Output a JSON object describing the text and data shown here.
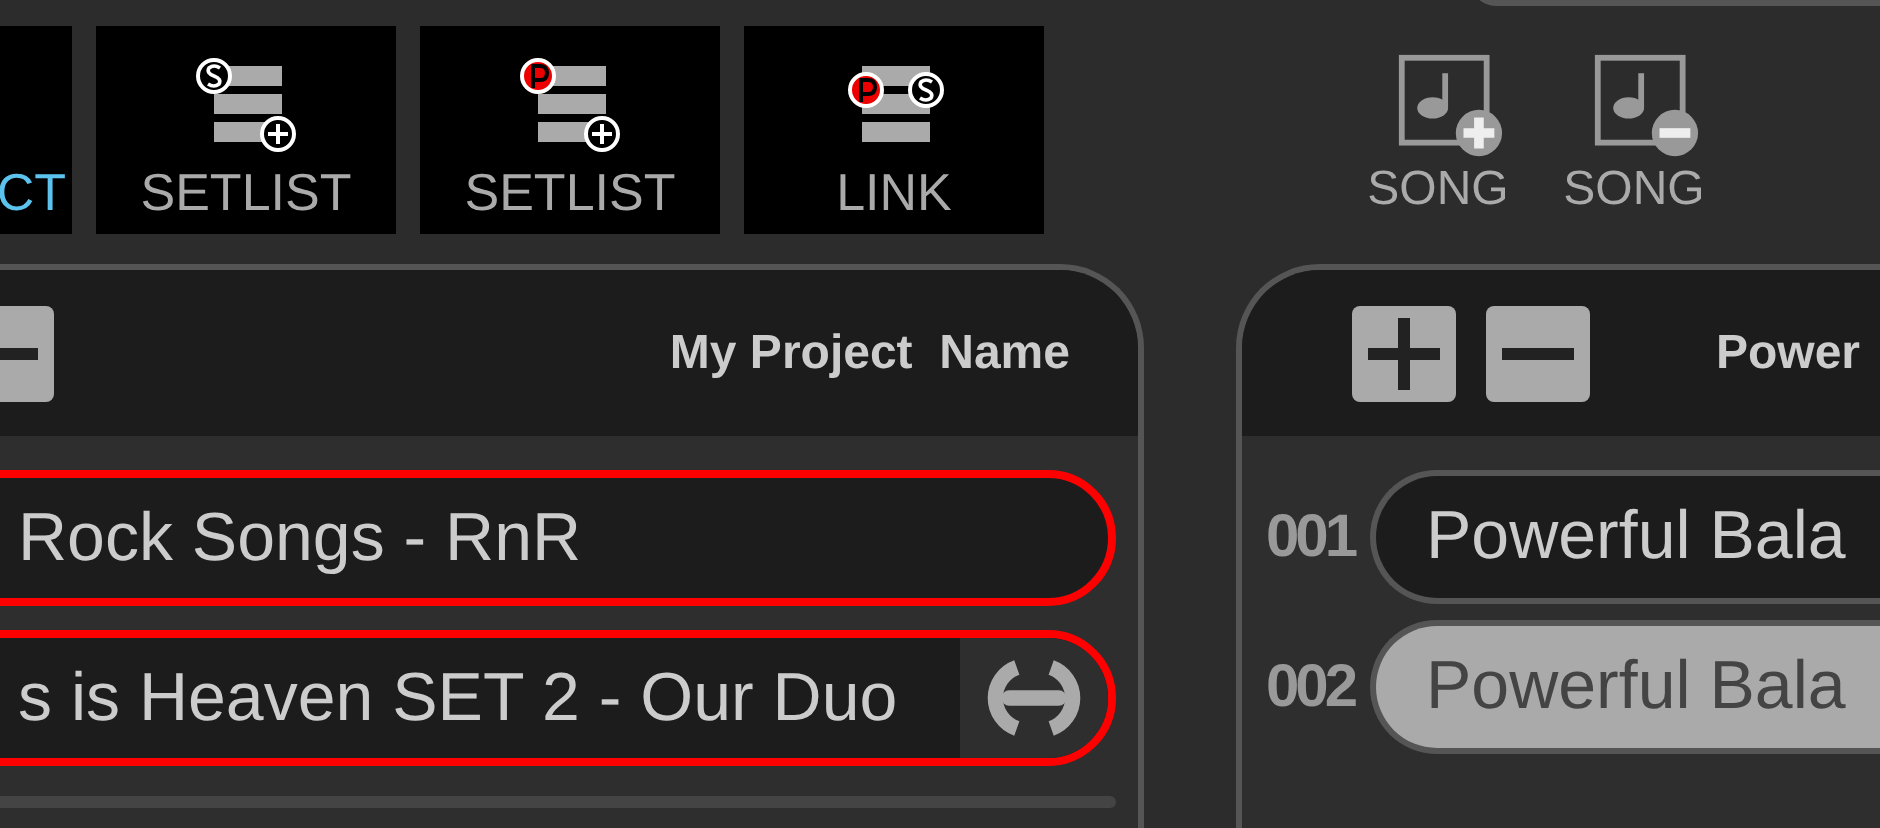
{
  "toolbar": [
    {
      "kind": "project",
      "label": "CT",
      "selected": true
    },
    {
      "kind": "add_setlist_s",
      "label": "SETLIST",
      "selected": false
    },
    {
      "kind": "add_setlist_p",
      "label": "SETLIST",
      "selected": false
    },
    {
      "kind": "link",
      "label": "LINK",
      "selected": false
    }
  ],
  "song_actions": [
    {
      "kind": "add",
      "label": "SONG"
    },
    {
      "kind": "remove",
      "label": "SONG"
    }
  ],
  "project_panel": {
    "title": "My Project  Name",
    "rows": [
      {
        "name": "Rock Songs - RnR",
        "highlighted": true,
        "linked": false
      },
      {
        "name": "s is Heaven SET 2 - Our Duo",
        "highlighted": true,
        "linked": true
      }
    ]
  },
  "setlist_panel": {
    "title": "Power",
    "rows": [
      {
        "number": "001",
        "name": "Powerful Bala",
        "selected": false
      },
      {
        "number": "002",
        "name": "Powerful Bala",
        "selected": true
      }
    ]
  }
}
